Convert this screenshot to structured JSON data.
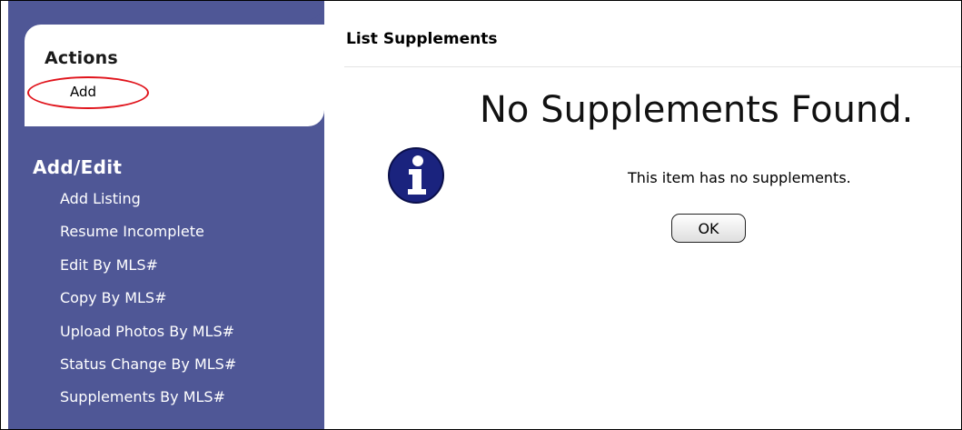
{
  "sidebar": {
    "actions": {
      "title": "Actions",
      "items": [
        {
          "label": "Add"
        }
      ]
    },
    "add_edit": {
      "title": "Add/Edit",
      "items": [
        {
          "label": "Add Listing"
        },
        {
          "label": "Resume Incomplete"
        },
        {
          "label": "Edit By MLS#"
        },
        {
          "label": "Copy By MLS#"
        },
        {
          "label": "Upload Photos By MLS#"
        },
        {
          "label": "Status Change By MLS#"
        },
        {
          "label": "Supplements By MLS#"
        }
      ]
    },
    "background_color": "#4f5796"
  },
  "main": {
    "title": "List Supplements",
    "headline": "No Supplements Found.",
    "message": "This item has no supplements.",
    "icon": "info-icon",
    "ok_label": "OK"
  },
  "colors": {
    "highlight_ellipse": "#e0131b",
    "info_icon": "#1a237e"
  }
}
